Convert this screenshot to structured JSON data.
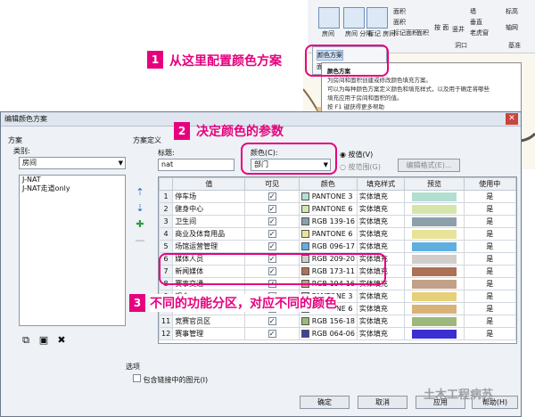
{
  "ribbon": {
    "buttons": [
      {
        "label": "房间"
      },
      {
        "label": "房间\n分隔"
      },
      {
        "label": "标记\n房间"
      }
    ],
    "small_items": [
      "面积",
      "面积",
      "标记面积",
      "面积"
    ],
    "tools": [
      "按\n面",
      "竖井",
      "墙",
      "垂直",
      "老虎窗",
      "标高",
      "轴网"
    ],
    "groups": [
      "洞口",
      "基准"
    ]
  },
  "popup": {
    "items": [
      "颜色方案",
      "面积和"
    ]
  },
  "tooltip": {
    "title": "颜色方案",
    "line1": "为房间和面积创建或修改颜色填充方案。",
    "line2": "可以为每种颜色方案定义颜色和填充样式，以及用于确定将哪些",
    "line3": "填充应用于房间和面积的值。",
    "help": "按 F1 键获得更多帮助"
  },
  "callouts": [
    {
      "num": "1",
      "text": "从这里配置颜色方案"
    },
    {
      "num": "2",
      "text": "决定颜色的参数"
    },
    {
      "num": "3",
      "text": "不同的功能分区，对应不同的颜色"
    }
  ],
  "dialog": {
    "title": "编辑颜色方案",
    "scheme_label": "方案",
    "category_label": "类别:",
    "category_value": "房间",
    "schemes": [
      "J-NAT",
      "J-NAT走道only"
    ],
    "definition_label": "方案定义",
    "title_label": "标题:",
    "title_value": "nat",
    "color_label": "颜色(C):",
    "color_value": "部门",
    "by_value_label": "按值(V)",
    "by_range_label": "按范围(G)",
    "edit_format_label": "编辑格式(E)...",
    "columns": [
      "值",
      "可见",
      "颜色",
      "填充样式",
      "预览",
      "使用中"
    ],
    "options_label": "选项",
    "include_links_label": "包含链接中的图元(I)",
    "ok_label": "确定",
    "cancel_label": "取消",
    "apply_label": "应用",
    "help_label": "帮助(H)"
  },
  "rows": [
    {
      "num": "1",
      "value": "停车场",
      "visible": "✓",
      "color_name": "PANTONE 3",
      "color": "#b2dfd2",
      "fill": "实体填充",
      "preview": "#b2dfd2",
      "inuse": "是"
    },
    {
      "num": "2",
      "value": "健身中心",
      "visible": "✓",
      "color_name": "PANTONE 6",
      "color": "#d4e7a8",
      "fill": "实体填充",
      "preview": "#d4e7a8",
      "inuse": "是"
    },
    {
      "num": "3",
      "value": "卫生间",
      "visible": "✓",
      "color_name": "RGB 139-16",
      "color": "#8ba0a8",
      "fill": "实体填充",
      "preview": "#8ba0a8",
      "inuse": "是"
    },
    {
      "num": "4",
      "value": "商业及体育用品",
      "visible": "✓",
      "color_name": "PANTONE 6",
      "color": "#e9e39a",
      "fill": "实体填充",
      "preview": "#e9e39a",
      "inuse": "是"
    },
    {
      "num": "5",
      "value": "场馆运营管理",
      "visible": "✓",
      "color_name": "RGB 096-17",
      "color": "#60afe0",
      "fill": "实体填充",
      "preview": "#60afe0",
      "inuse": "是"
    },
    {
      "num": "6",
      "value": "媒体人员",
      "visible": "✓",
      "color_name": "RGB 209-20",
      "color": "#d1cdc8",
      "fill": "实体填充",
      "preview": "#d1cdc8",
      "inuse": "是"
    },
    {
      "num": "7",
      "value": "新闻媒体",
      "visible": "✓",
      "color_name": "RGB 173-11",
      "color": "#ad7156",
      "fill": "实体填充",
      "preview": "#ad7156",
      "inuse": "是"
    },
    {
      "num": "8",
      "value": "赛事交通",
      "visible": "✓",
      "color_name": "RGB 194-16",
      "color": "#c2a08a",
      "fill": "实体填充",
      "preview": "#c2a08a",
      "inuse": "是"
    },
    {
      "num": "9",
      "value": "观众",
      "visible": "✓",
      "color_name": "PANTONE 3",
      "color": "#e6d07a",
      "fill": "实体填充",
      "preview": "#e6d07a",
      "inuse": "是"
    },
    {
      "num": "10",
      "value": "设备机房",
      "visible": "✓",
      "color_name": "PANTONE 6",
      "color": "#d9b27a",
      "fill": "实体填充",
      "preview": "#d9b27a",
      "inuse": "是"
    },
    {
      "num": "11",
      "value": "竞赛官员区",
      "visible": "✓",
      "color_name": "RGB 156-18",
      "color": "#9cb87c",
      "fill": "实体填充",
      "preview": "#9cb87c",
      "inuse": "是"
    },
    {
      "num": "12",
      "value": "赛事管理",
      "visible": "✓",
      "color_name": "RGB 064-06",
      "color": "#4040a0",
      "fill": "实体填充",
      "preview": "#3b2fd0",
      "inuse": "是"
    }
  ],
  "watermark": "土木工程病苏"
}
